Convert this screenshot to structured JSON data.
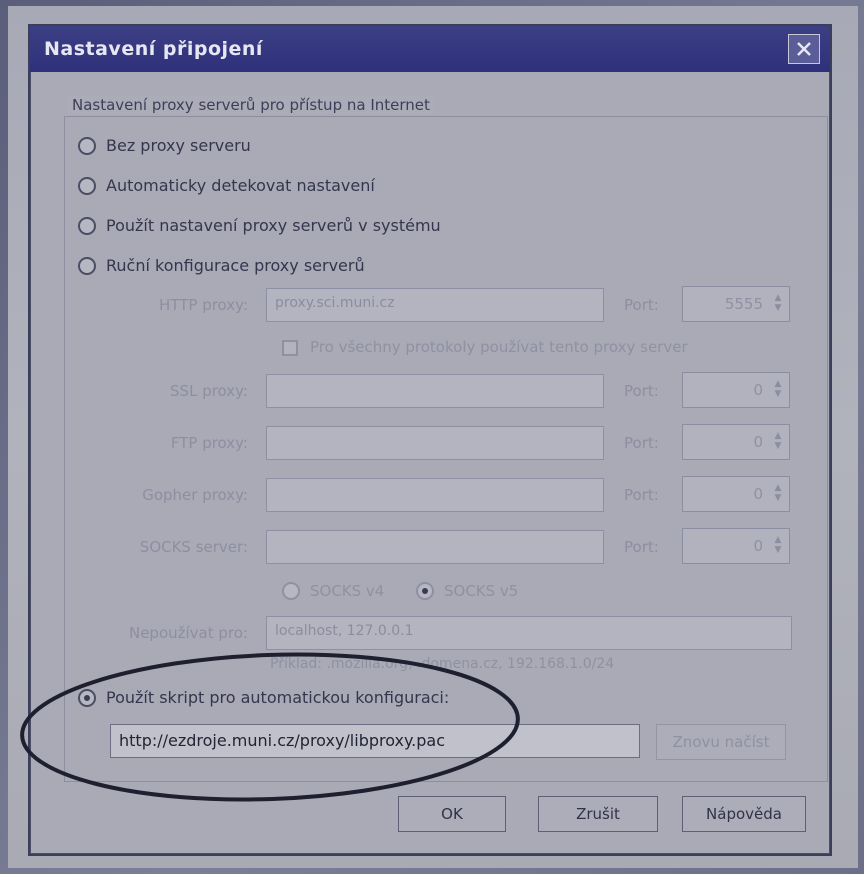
{
  "dialog": {
    "title": "Nastavení připojení",
    "group_caption": "Nastavení proxy serverů pro přístup na Internet"
  },
  "radios": {
    "no_proxy": "Bez proxy serveru",
    "auto_detect": "Automaticky detekovat nastavení",
    "system_proxy": "Použít nastavení proxy serverů v systému",
    "manual": "Ruční konfigurace proxy serverů",
    "pac_script": "Použít skript pro automatickou konfiguraci:"
  },
  "manual": {
    "http_label": "HTTP proxy:",
    "http_value": "proxy.sci.muni.cz",
    "http_port": "5555",
    "same_for_all_label": "Pro všechny protokoly používat tento proxy server",
    "ssl_label": "SSL proxy:",
    "ssl_port": "0",
    "ftp_label": "FTP proxy:",
    "ftp_port": "0",
    "gopher_label": "Gopher proxy:",
    "gopher_port": "0",
    "socks_label": "SOCKS server:",
    "socks_port": "0",
    "port_label": "Port:",
    "socks_v4": "SOCKS v4",
    "socks_v5": "SOCKS v5",
    "no_proxy_label": "Nepoužívat pro:",
    "no_proxy_value": "localhost, 127.0.0.1",
    "example_text": "Příklad: .mozilla.org, .domena.cz, 192.168.1.0/24"
  },
  "pac": {
    "url": "http://ezdroje.muni.cz/proxy/libproxy.pac",
    "reload_button": "Znovu načíst"
  },
  "buttons": {
    "ok": "OK",
    "cancel": "Zrušit",
    "help": "Nápověda"
  },
  "colors": {
    "titlebar": "#2e317a",
    "dialog_bg": "#a9aab6",
    "annotation_ellipse": "#1e2030"
  }
}
